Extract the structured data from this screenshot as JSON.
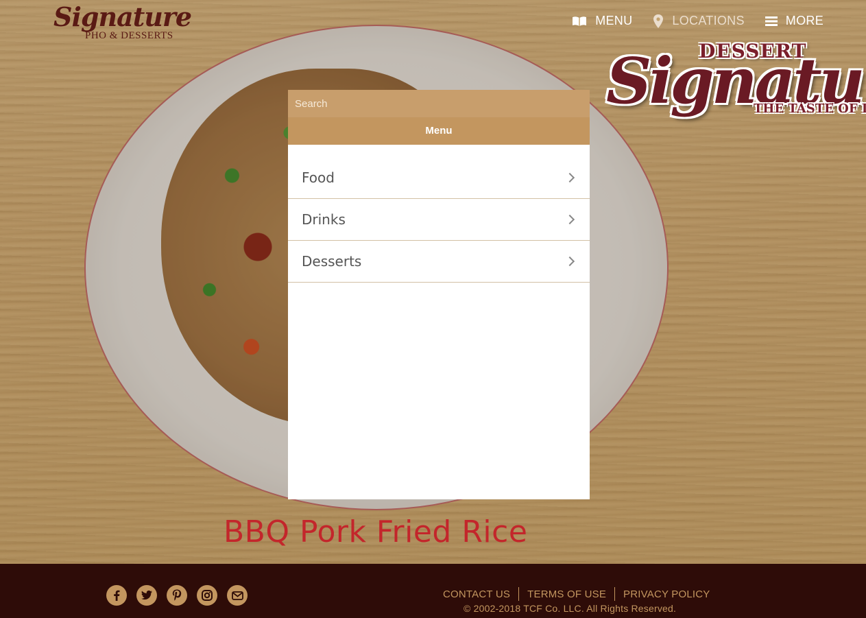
{
  "brand": {
    "logo_script": "Signature",
    "logo_sub": "PHO & DESSERTS"
  },
  "topnav": {
    "menu_label": "MENU",
    "locations_label": "LOCATIONS",
    "more_label": "MORE"
  },
  "badge": {
    "top": "DESSERT",
    "big": "Signatu",
    "bottom": "THE TASTE OF LU"
  },
  "panel": {
    "search_placeholder": "Search",
    "title": "Menu",
    "items": [
      {
        "label": "Food"
      },
      {
        "label": "Drinks"
      },
      {
        "label": "Desserts"
      }
    ]
  },
  "dish_title": "BBQ Pork Fried Rice",
  "footer": {
    "social": [
      "facebook-icon",
      "twitter-icon",
      "pinterest-icon",
      "instagram-icon",
      "email-icon"
    ],
    "links": {
      "contact": "CONTACT US",
      "terms": "TERMS OF USE",
      "privacy": "PRIVACY POLICY"
    },
    "copyright": "© 2002-2018 TCF Co. LLC. All Rights Reserved."
  },
  "colors": {
    "accent": "#c3965f",
    "footer_bg": "#2e0c08",
    "dish_title": "#c3262b",
    "brand": "#5a1a14"
  }
}
